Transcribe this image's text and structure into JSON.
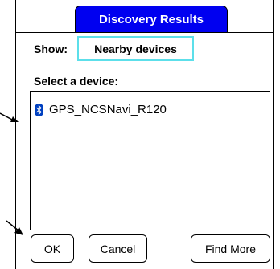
{
  "window": {
    "title": "Discovery Results"
  },
  "filter": {
    "label": "Show:",
    "selected": "Nearby devices"
  },
  "list": {
    "label": "Select a device:",
    "items": [
      {
        "name": "GPS_NCSNavi_R120",
        "icon": "bluetooth-icon"
      }
    ]
  },
  "buttons": {
    "ok": "OK",
    "cancel": "Cancel",
    "find_more": "Find More"
  },
  "colors": {
    "title_bg": "#0000f0",
    "title_text": "#ffffff",
    "dropdown_border": "#5cdfea",
    "bluetooth": "#0040c0"
  }
}
